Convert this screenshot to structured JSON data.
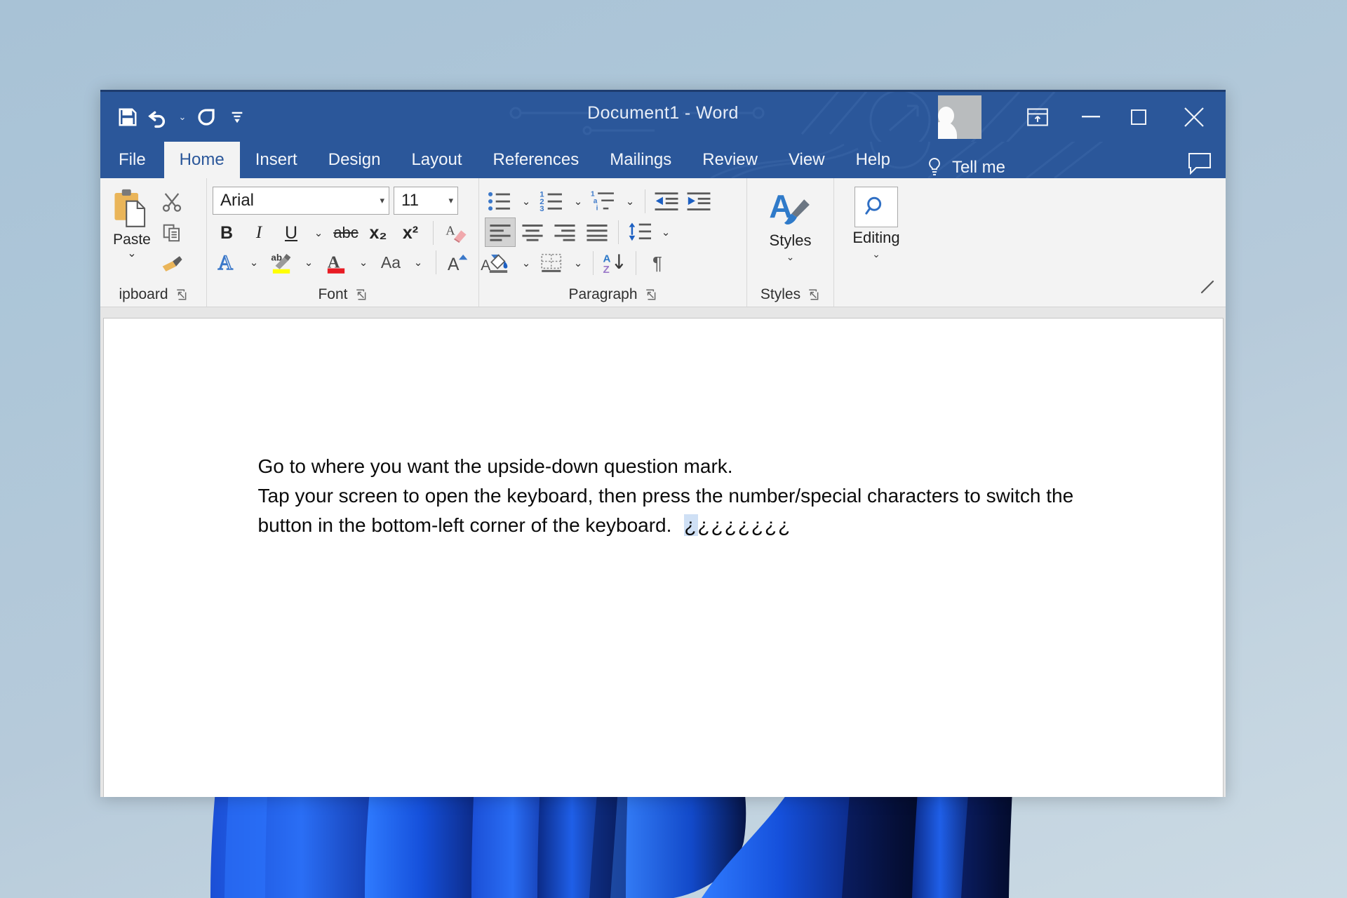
{
  "window": {
    "title": "Document1  -  Word",
    "accent_color": "#2b579a"
  },
  "quick_access_toolbar": {
    "items": [
      {
        "name": "save",
        "icon": "save-icon",
        "label": "Save"
      },
      {
        "name": "undo",
        "icon": "undo-icon",
        "label": "Undo"
      },
      {
        "name": "undo-dropdown",
        "icon": "chevron-down-icon",
        "label": "Undo options"
      },
      {
        "name": "redo",
        "icon": "redo-icon",
        "label": "Redo"
      },
      {
        "name": "customize",
        "icon": "customize-qat-icon",
        "label": "Customize Quick Access Toolbar"
      }
    ]
  },
  "window_controls": {
    "ribbon_display_options": "Ribbon Display Options",
    "minimize": "–",
    "maximize": "☐",
    "close": "✕"
  },
  "account": {
    "avatar_alt": "User account"
  },
  "tabs": [
    {
      "label": "File",
      "active": false
    },
    {
      "label": "Home",
      "active": true
    },
    {
      "label": "Insert",
      "active": false
    },
    {
      "label": "Design",
      "active": false
    },
    {
      "label": "Layout",
      "active": false
    },
    {
      "label": "References",
      "active": false
    },
    {
      "label": "Mailings",
      "active": false
    },
    {
      "label": "Review",
      "active": false
    },
    {
      "label": "View",
      "active": false
    },
    {
      "label": "Help",
      "active": false
    }
  ],
  "tell_me": {
    "label": "Tell me",
    "icon": "lightbulb-icon"
  },
  "comments": {
    "icon": "comment-icon",
    "label": "Comments"
  },
  "ribbon": {
    "clipboard": {
      "label": "ipboard",
      "paste_label": "Paste",
      "paste_caret": "⌄",
      "cut_label": "Cut",
      "copy_label": "Copy",
      "format_painter_label": "Format Painter",
      "dialog_launcher": "Clipboard settings"
    },
    "font": {
      "label": "Font",
      "font_name": "Arial",
      "font_size": "11",
      "bold": "B",
      "italic": "I",
      "underline": "U",
      "underline_caret": "⌄",
      "strikethrough": "abc",
      "subscript": "x₂",
      "superscript": "x²",
      "clear_formatting": "Clear All Formatting",
      "text_effects": "Text Effects and Typography",
      "text_highlight": "Text Highlight Color",
      "font_color": "Font Color",
      "change_case": "Aa",
      "change_case_caret": "⌄",
      "grow_font": "A",
      "shrink_font": "A",
      "dialog_launcher": "Font settings"
    },
    "paragraph": {
      "label": "Paragraph",
      "bullets": "Bullets",
      "numbering": "Numbering",
      "multilevel_list": "Multilevel List",
      "decrease_indent": "Decrease Indent",
      "increase_indent": "Increase Indent",
      "align_left": "Align Left",
      "align_center": "Center",
      "align_right": "Align Right",
      "justify": "Justify",
      "line_spacing": "Line and Paragraph Spacing",
      "shading": "Shading",
      "borders": "Borders",
      "sort": "Sort",
      "show_marks": "¶",
      "dialog_launcher": "Paragraph settings"
    },
    "styles": {
      "label": "Styles",
      "button_label": "Styles",
      "caret": "⌄",
      "dialog_launcher": "Styles settings"
    },
    "editing": {
      "button_label": "Editing",
      "icon": "search-icon",
      "caret": "⌄"
    },
    "collapse": "Collapse the Ribbon"
  },
  "document": {
    "line1": "Go to where you want the upside-down question mark.",
    "line2": "Tap your screen to open the keyboard, then press the number/special characters to switch the",
    "line3": "button in the bottom-left corner of the keyboard.",
    "inverted_marks_first": "¿",
    "inverted_marks_rest": "¿¿¿¿¿¿¿"
  }
}
